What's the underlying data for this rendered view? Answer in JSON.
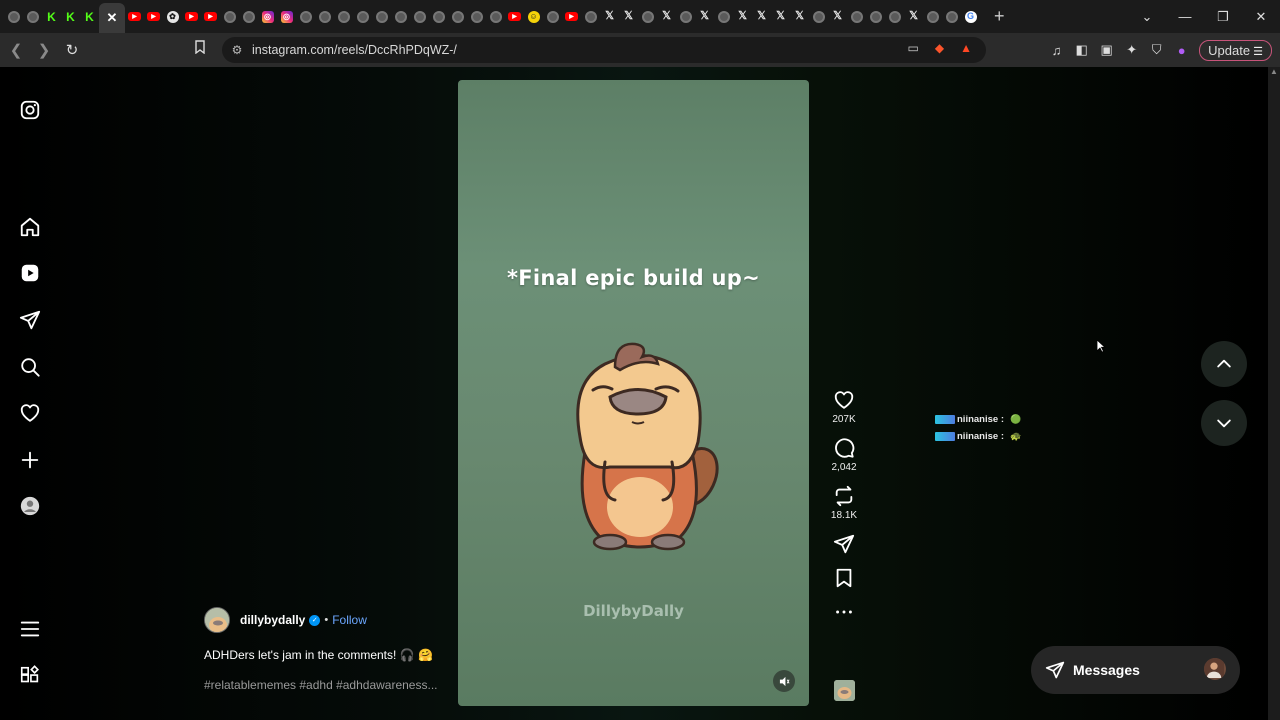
{
  "browser": {
    "url": "instagram.com/reels/DccRhPDqWZ-/",
    "update_label": "Update",
    "tabs": [
      {
        "icon": "gray"
      },
      {
        "icon": "gray"
      },
      {
        "icon": "kick"
      },
      {
        "icon": "kick"
      },
      {
        "icon": "kick"
      },
      {
        "icon": "close-active"
      },
      {
        "icon": "yt"
      },
      {
        "icon": "yt"
      },
      {
        "icon": "ai"
      },
      {
        "icon": "yt"
      },
      {
        "icon": "yt"
      },
      {
        "icon": "gray"
      },
      {
        "icon": "gray"
      },
      {
        "icon": "ig"
      },
      {
        "icon": "ig"
      },
      {
        "icon": "gray"
      },
      {
        "icon": "gray"
      },
      {
        "icon": "gray"
      },
      {
        "icon": "gray"
      },
      {
        "icon": "gray"
      },
      {
        "icon": "gray"
      },
      {
        "icon": "gray"
      },
      {
        "icon": "gray"
      },
      {
        "icon": "gray"
      },
      {
        "icon": "gray"
      },
      {
        "icon": "gray"
      },
      {
        "icon": "yt"
      },
      {
        "icon": "yellow"
      },
      {
        "icon": "gray"
      },
      {
        "icon": "yt"
      },
      {
        "icon": "gray"
      },
      {
        "icon": "x"
      },
      {
        "icon": "x"
      },
      {
        "icon": "gray"
      },
      {
        "icon": "x"
      },
      {
        "icon": "gray"
      },
      {
        "icon": "x"
      },
      {
        "icon": "gray"
      },
      {
        "icon": "x"
      },
      {
        "icon": "x"
      },
      {
        "icon": "x"
      },
      {
        "icon": "x"
      },
      {
        "icon": "gray"
      },
      {
        "icon": "x"
      },
      {
        "icon": "gray"
      },
      {
        "icon": "gray"
      },
      {
        "icon": "gray"
      },
      {
        "icon": "x"
      },
      {
        "icon": "gray"
      },
      {
        "icon": "gray"
      },
      {
        "icon": "google"
      }
    ]
  },
  "sidebar": {
    "items": [
      {
        "name": "instagram-logo-icon"
      },
      {
        "name": "home-icon"
      },
      {
        "name": "reels-icon"
      },
      {
        "name": "direct-icon"
      },
      {
        "name": "search-icon"
      },
      {
        "name": "notifications-icon"
      },
      {
        "name": "create-icon"
      },
      {
        "name": "profile-icon"
      },
      {
        "name": "more-menu-icon"
      },
      {
        "name": "apps-icon"
      }
    ]
  },
  "reel": {
    "caption_overlay": "*Final epic build up~",
    "watermark": "DillybyDally",
    "author": "dillybydally",
    "follow_label": "Follow",
    "description": "ADHDers let's jam in the comments! 🎧 🤗",
    "hashtags": "#relatablememes #adhd #adhdawareness..."
  },
  "actions": {
    "likes": "207K",
    "comments": "2,042",
    "reposts": "18.1K"
  },
  "chat": {
    "rows": [
      {
        "user": "niinanise :",
        "emoji": "🟢"
      },
      {
        "user": "niinanise :",
        "emoji": "🐢"
      }
    ]
  },
  "messages": {
    "label": "Messages"
  },
  "colors": {
    "accent_follow": "#6ca7ff",
    "verified": "#0095f6",
    "video_bg": "#68886f"
  }
}
